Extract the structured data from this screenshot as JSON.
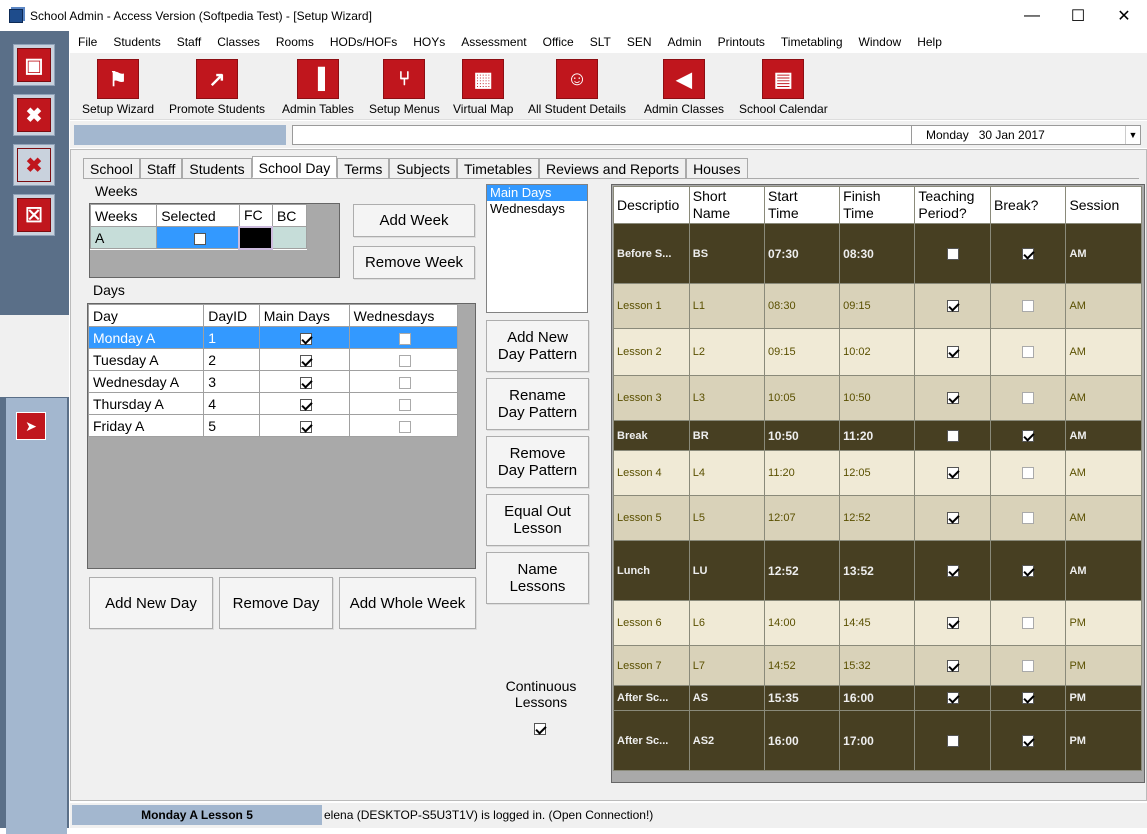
{
  "window": {
    "title": "School Admin - Access Version (Softpedia Test) - [Setup Wizard]"
  },
  "menu": [
    "File",
    "Students",
    "Staff",
    "Classes",
    "Rooms",
    "HODs/HOFs",
    "HOYs",
    "Assessment",
    "Office",
    "SLT",
    "SEN",
    "Admin",
    "Printouts",
    "Timetabling",
    "Window",
    "Help"
  ],
  "toolbar": [
    {
      "label": "Setup Wizard",
      "icon": "signpost-icon"
    },
    {
      "label": "Promote Students",
      "icon": "export-arrow-icon"
    },
    {
      "label": "Admin Tables",
      "icon": "bar-chart-icon"
    },
    {
      "label": "Setup Menus",
      "icon": "branch-icon"
    },
    {
      "label": "Virtual Map",
      "icon": "map-icon"
    },
    {
      "label": "All Student Details",
      "icon": "person-icon"
    },
    {
      "label": "Admin Classes",
      "icon": "back-arrow-icon"
    },
    {
      "label": "School Calendar",
      "icon": "calendar-icon"
    }
  ],
  "date_selector": {
    "value": "Monday   30 Jan 2017"
  },
  "tabs": [
    "School",
    "Staff",
    "Students",
    "School Day",
    "Terms",
    "Subjects",
    "Timetables",
    "Reviews and Reports",
    "Houses"
  ],
  "weeks": {
    "label": "Weeks",
    "headers": [
      "Weeks",
      "Selected",
      "FC",
      "BC"
    ],
    "rows": [
      {
        "week": "A",
        "selected": false
      }
    ],
    "add_button": "Add Week",
    "remove_button": "Remove Week"
  },
  "days": {
    "label": "Days",
    "headers": [
      "Day",
      "DayID",
      "Main Days",
      "Wednesdays"
    ],
    "rows": [
      {
        "day": "Monday A",
        "id": "1",
        "main": true,
        "wed": false
      },
      {
        "day": "Tuesday A",
        "id": "2",
        "main": true,
        "wed": false
      },
      {
        "day": "Wednesday A",
        "id": "3",
        "main": true,
        "wed": false
      },
      {
        "day": "Thursday A",
        "id": "4",
        "main": true,
        "wed": false
      },
      {
        "day": "Friday A",
        "id": "5",
        "main": true,
        "wed": false
      }
    ],
    "buttons": [
      "Add New Day",
      "Remove Day",
      "Add Whole Week"
    ]
  },
  "patterns": {
    "items": [
      "Main Days",
      "Wednesdays"
    ],
    "buttons": [
      "Add New\nDay Pattern",
      "Rename\nDay Pattern",
      "Remove\nDay Pattern",
      "Equal Out\nLesson",
      "Name\nLessons"
    ],
    "continuous_label": "Continuous\nLessons",
    "continuous_checked": true
  },
  "schedule": {
    "headers": [
      "Descriptio",
      "Short\nName",
      "Start\nTime",
      "Finish\nTime",
      "Teaching\nPeriod?",
      "Break?",
      "Session"
    ],
    "rows": [
      {
        "desc": "Before S...",
        "short": "BS",
        "start": "07:30",
        "finish": "08:30",
        "teaching": false,
        "brk": true,
        "session": "AM",
        "style": "dark"
      },
      {
        "desc": "Lesson 1",
        "short": "L1",
        "start": "08:30",
        "finish": "09:15",
        "teaching": true,
        "brk": false,
        "session": "AM",
        "style": "la"
      },
      {
        "desc": "Lesson 2",
        "short": "L2",
        "start": "09:15",
        "finish": "10:02",
        "teaching": true,
        "brk": false,
        "session": "AM",
        "style": "lb"
      },
      {
        "desc": "Lesson 3",
        "short": "L3",
        "start": "10:05",
        "finish": "10:50",
        "teaching": true,
        "brk": false,
        "session": "AM",
        "style": "la"
      },
      {
        "desc": "Break",
        "short": "BR",
        "start": "10:50",
        "finish": "11:20",
        "teaching": false,
        "brk": true,
        "session": "AM",
        "style": "dark"
      },
      {
        "desc": "Lesson 4",
        "short": "L4",
        "start": "11:20",
        "finish": "12:05",
        "teaching": true,
        "brk": false,
        "session": "AM",
        "style": "lb"
      },
      {
        "desc": "Lesson 5",
        "short": "L5",
        "start": "12:07",
        "finish": "12:52",
        "teaching": true,
        "brk": false,
        "session": "AM",
        "style": "la"
      },
      {
        "desc": "Lunch",
        "short": "LU",
        "start": "12:52",
        "finish": "13:52",
        "teaching": true,
        "brk": true,
        "session": "AM",
        "style": "dark"
      },
      {
        "desc": "Lesson 6",
        "short": "L6",
        "start": "14:00",
        "finish": "14:45",
        "teaching": true,
        "brk": false,
        "session": "PM",
        "style": "lb"
      },
      {
        "desc": "Lesson 7",
        "short": "L7",
        "start": "14:52",
        "finish": "15:32",
        "teaching": true,
        "brk": false,
        "session": "PM",
        "style": "la"
      },
      {
        "desc": "After Sc...",
        "short": "AS",
        "start": "15:35",
        "finish": "16:00",
        "teaching": true,
        "brk": true,
        "session": "PM",
        "style": "dark"
      },
      {
        "desc": "After Sc...",
        "short": "AS2",
        "start": "16:00",
        "finish": "17:00",
        "teaching": false,
        "brk": true,
        "session": "PM",
        "style": "dark"
      }
    ]
  },
  "status": {
    "left": "Monday A Lesson 5",
    "right": "elena (DESKTOP-S5U3T1V) is logged in. (Open Connection!)"
  }
}
